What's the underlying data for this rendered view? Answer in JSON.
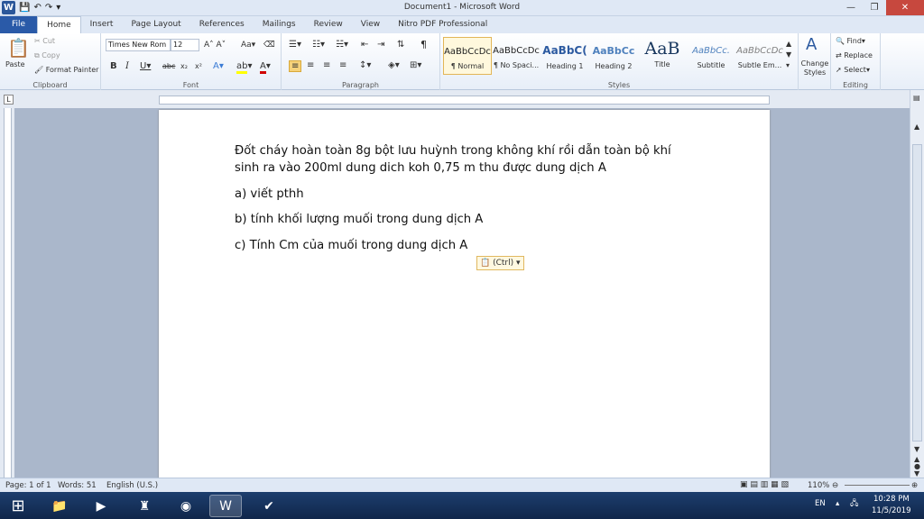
{
  "window": {
    "title": "Document1 - Microsoft Word"
  },
  "tabs": [
    "File",
    "Home",
    "Insert",
    "Page Layout",
    "References",
    "Mailings",
    "Review",
    "View",
    "Nitro PDF Professional"
  ],
  "clipboard": {
    "paste": "Paste",
    "cut": "Cut",
    "copy": "Copy",
    "format_painter": "Format Painter",
    "label": "Clipboard"
  },
  "font": {
    "name": "Times New Rom",
    "size": "12",
    "label": "Font"
  },
  "paragraph": {
    "label": "Paragraph"
  },
  "styles": {
    "items": [
      {
        "sample": "AaBbCcDc",
        "name": "¶ Normal"
      },
      {
        "sample": "AaBbCcDc",
        "name": "¶ No Spaci..."
      },
      {
        "sample": "AaBbC(",
        "name": "Heading 1"
      },
      {
        "sample": "AaBbCc",
        "name": "Heading 2"
      },
      {
        "sample": "AaB",
        "name": "Title"
      },
      {
        "sample": "AaBbCc.",
        "name": "Subtitle"
      },
      {
        "sample": "AaBbCcDc",
        "name": "Subtle Em..."
      }
    ],
    "change_styles": "Change Styles",
    "label": "Styles"
  },
  "editing": {
    "find": "Find",
    "replace": "Replace",
    "select": "Select",
    "label": "Editing"
  },
  "document": {
    "line1": "Đốt cháy hoàn toàn 8g bột lưu huỳnh trong không khí rồi dẫn toàn bộ khí",
    "line2": "sinh ra vào 200ml dung dich koh 0,75 m thu được dung dịch A",
    "line3": "a) viết pthh",
    "line4": "b) tính khối lượng muối trong dung dịch A",
    "line5": "c) Tính Cm của muối trong dung dịch A",
    "paste_options": "(Ctrl)"
  },
  "status": {
    "page": "Page: 1 of 1",
    "words": "Words: 51",
    "language": "English (U.S.)",
    "zoom": "110%"
  },
  "taskbar": {
    "lang": "EN",
    "time": "10:28 PM",
    "date": "11/5/2019"
  }
}
